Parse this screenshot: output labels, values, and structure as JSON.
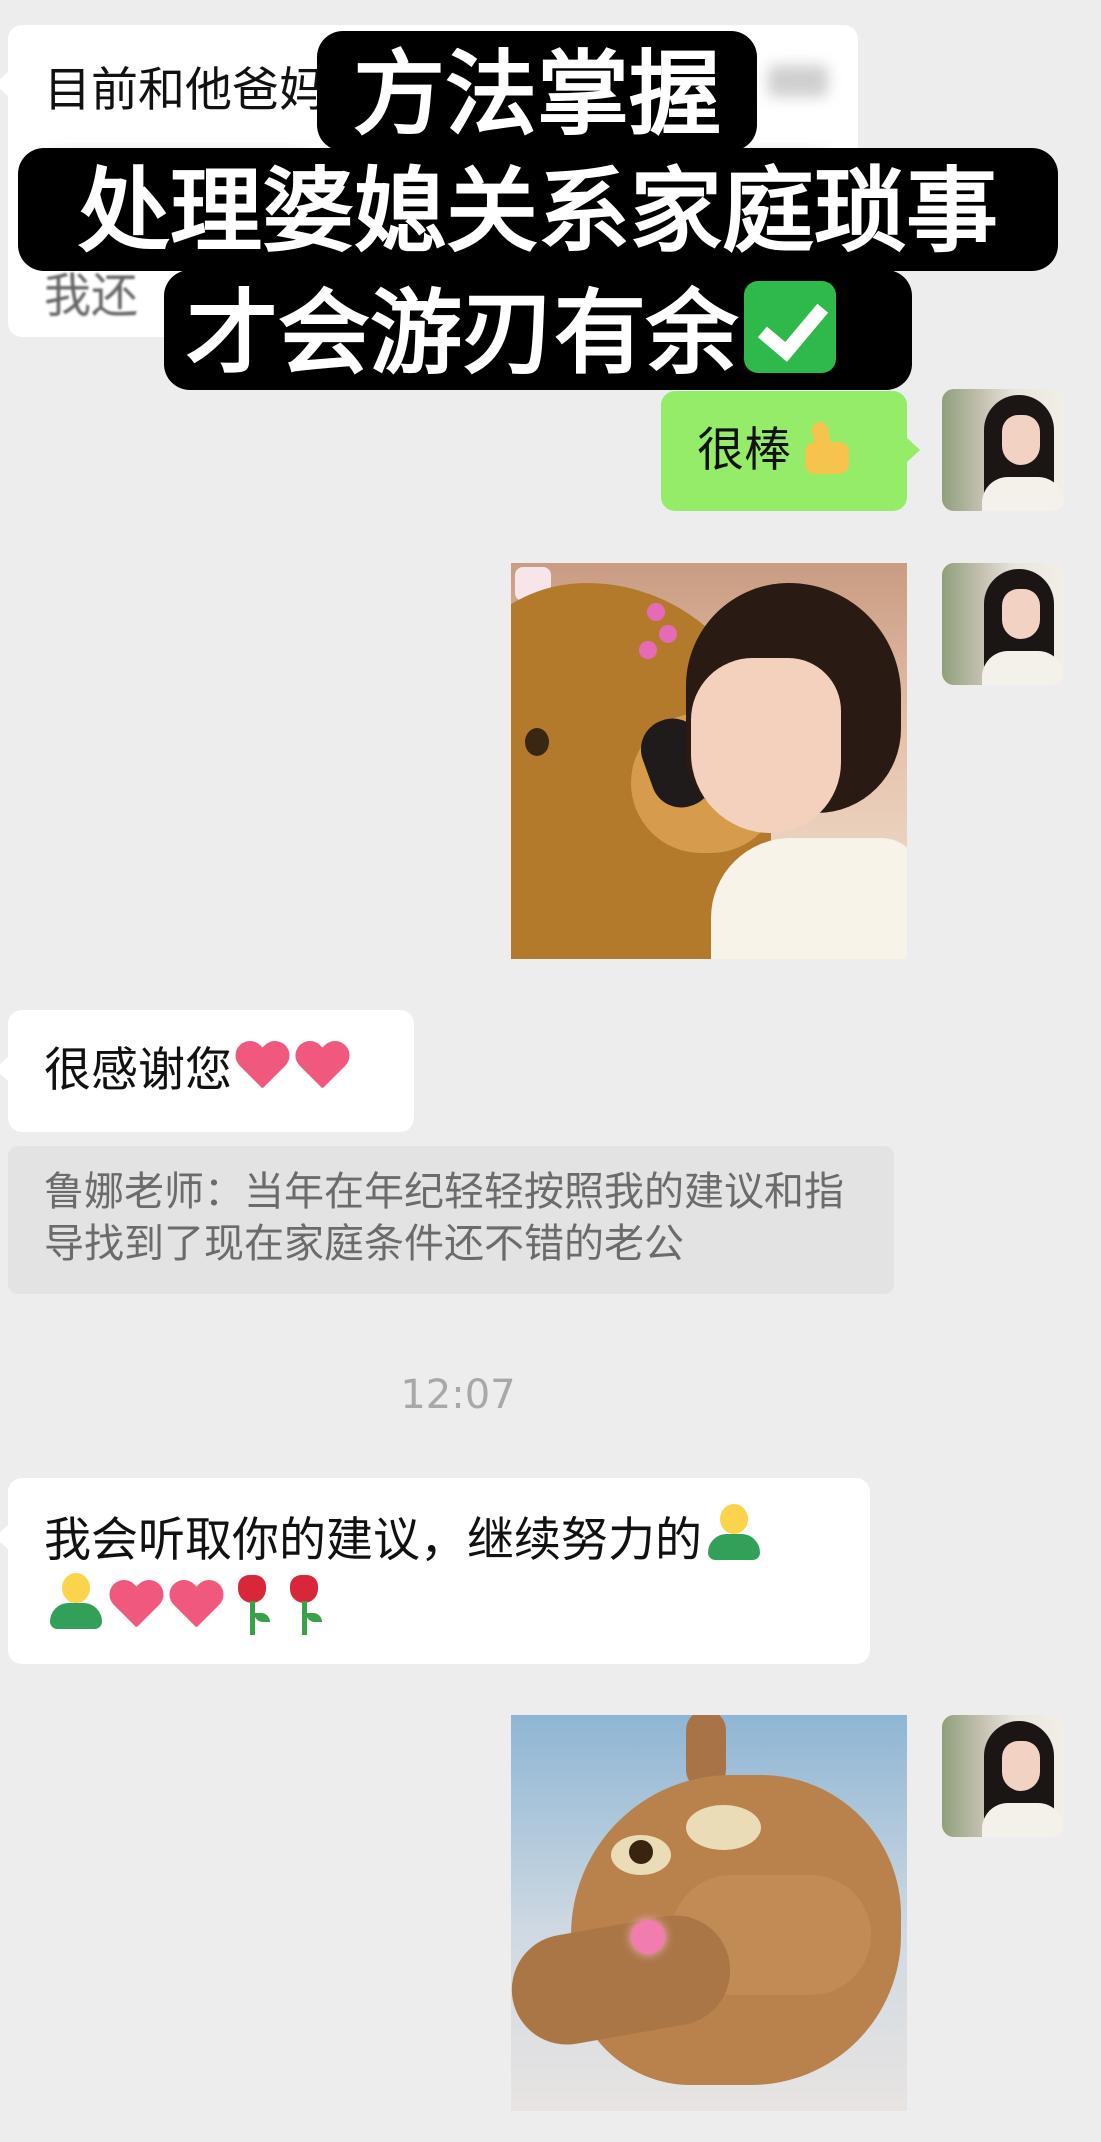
{
  "title_overlay": {
    "line1": "方法掌握",
    "line2": "处理婆媳关系家庭琐事",
    "line3": "才会游刃有余"
  },
  "messages": {
    "blurred_first": "目前和他爸妈",
    "blurred_third": "我还",
    "very_good": "很棒",
    "thanks": "很感谢您",
    "quote": "鲁娜老师：当年在年纪轻轻按照我的建议和指导找到了现在家庭条件还不错的老公",
    "timestamp": "12:07",
    "advice_line1": "我会听取你的建议，继续努力的",
    "advice_line2": ""
  },
  "icons": {
    "check": "check-mark-button-icon",
    "thumb": "thumbs-up-icon",
    "heart": "red-heart-icon",
    "person": "person-icon",
    "rose": "rose-icon"
  },
  "colors": {
    "chat_bg": "#ededed",
    "self_bubble": "#95ec69",
    "other_bubble": "#ffffff",
    "quote_bg": "#e3e3e3"
  }
}
